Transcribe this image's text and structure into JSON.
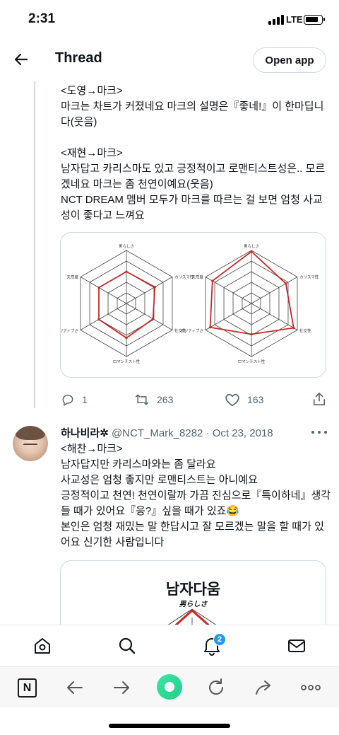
{
  "status": {
    "time": "2:31",
    "network": "LTE"
  },
  "header": {
    "title": "Thread",
    "open_app": "Open app"
  },
  "tweet1": {
    "text": "<도영→마크>\n마크는 차트가 커졌네요 마크의 설명은『좋네!』이 한마딥니다(웃음)\n\n<재현→마크>\n남자답고 카리스마도 있고 긍정적이고 로맨티스트성은.. 모르겠네요 마크는 좀 천연이예요(웃음)\nNCT DREAM 멤버 모두가 마크를 따르는 걸 보면 엄청 사교성이 좋다고 느껴요",
    "chart_labels": {
      "top": "男らしさ",
      "upper_right": "カリスマ性",
      "lower_right": "社交性",
      "bottom": "ロマンチスト性",
      "lower_left": "ポジティブさ",
      "upper_left": "天然度"
    },
    "replies": "1",
    "retweets": "263",
    "likes": "163"
  },
  "tweet2": {
    "name": "하나비라✲",
    "handle": "@NCT_Mark_8282",
    "date": "Oct 23, 2018",
    "text": "<해찬→마크>\n남자답지만 카리스마와는 좀 달라요\n사교성은 엄청 좋지만 로맨티스트는 아니예요\n긍정적이고 천연! 천연이랄까 가끔 진심으로『특이하네』생각들 때가 있어요『응?』싶을 때가 있죠😂\n본인은 엄청 재밌는 말 한답시고 잘 모르겠는 말을 할 때가 있어요 신기한 사람입니다",
    "image_title": "남자다움",
    "image_subtitle": "男らしさ"
  },
  "tabbar": {
    "notification_count": "2"
  },
  "colors": {
    "accent": "#1d9bf0",
    "chart_line": "#c62828",
    "muted": "#536471",
    "naver": "#1fcf8a"
  },
  "icons": [
    "back-arrow-icon",
    "reply-icon",
    "retweet-icon",
    "like-icon",
    "share-icon",
    "more-icon",
    "home-icon",
    "search-icon",
    "notifications-icon",
    "messages-icon",
    "naver-n-icon",
    "browser-back-icon",
    "browser-forward-icon",
    "naver-green-dot-icon",
    "reload-icon",
    "browser-share-icon",
    "browser-more-icon"
  ]
}
